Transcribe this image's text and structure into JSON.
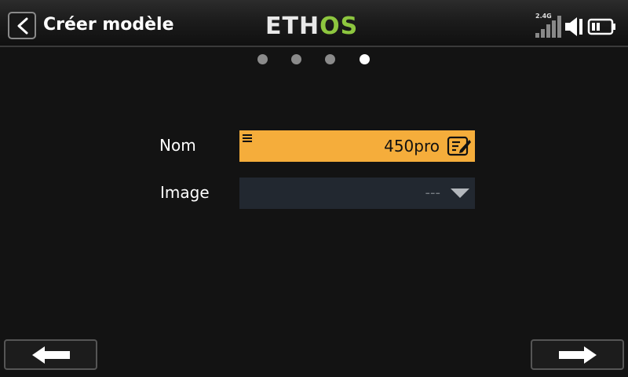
{
  "header": {
    "title": "Créer modèle",
    "logo_part1": "ETH",
    "logo_part2": "OS",
    "rssi_label": "2.4G",
    "back_icon": "chevron-left-icon",
    "signal_icon": "signal-bars-icon",
    "volume_icon": "speaker-icon",
    "battery_icon": "battery-icon"
  },
  "pager": {
    "total": 4,
    "active": 4
  },
  "form": {
    "name": {
      "label": "Nom",
      "value": "450pro",
      "icon": "edit-icon"
    },
    "image": {
      "label": "Image",
      "value": "---",
      "icon": "dropdown-arrow-icon"
    }
  },
  "nav": {
    "prev_icon": "arrow-left-icon",
    "next_icon": "arrow-right-icon"
  },
  "colors": {
    "accent": "#f5ad3b",
    "logo_green": "#8dc63f",
    "background": "#131313"
  }
}
